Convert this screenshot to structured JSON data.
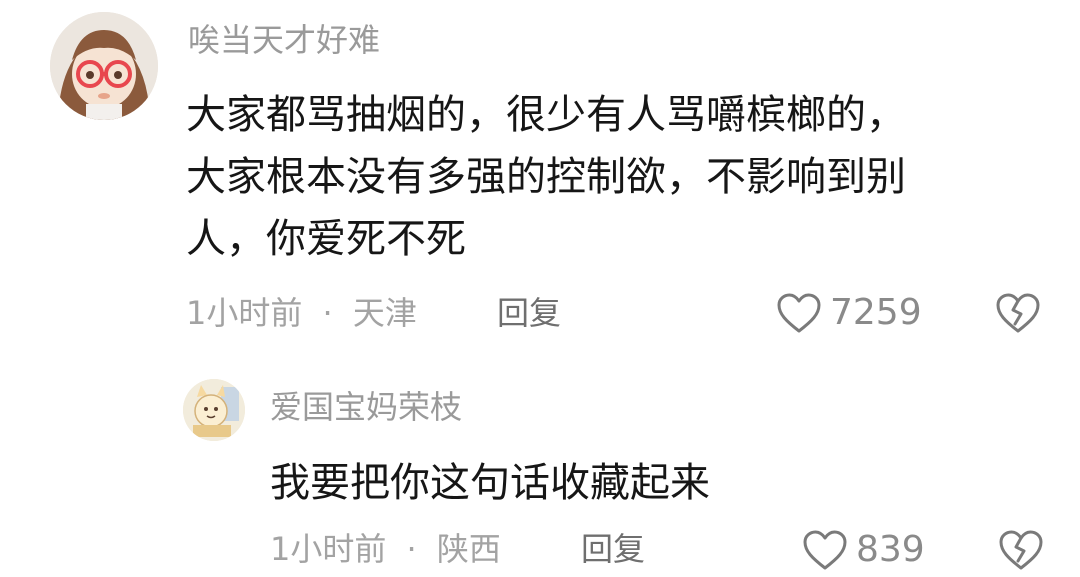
{
  "comment": {
    "username": "唉当天才好难",
    "content": "大家都骂抽烟的，很少有人骂嚼槟榔的，\n大家根本没有多强的控制欲，不影响到别\n人，你爱死不死",
    "time": "1小时前",
    "separator": "·",
    "location": "天津",
    "reply_label": "回复",
    "like_count": "7259"
  },
  "reply": {
    "username": "爱国宝妈荣枝",
    "content": "我要把你这句话收藏起来",
    "time": "1小时前",
    "separator": "·",
    "location": "陕西",
    "reply_label": "回复",
    "like_count": "839"
  },
  "icons": {
    "like": "heart-outline-icon",
    "dislike": "broken-heart-icon"
  },
  "colors": {
    "text": "#161616",
    "muted": "#9a9a9a",
    "icon": "#7a7a7a"
  }
}
